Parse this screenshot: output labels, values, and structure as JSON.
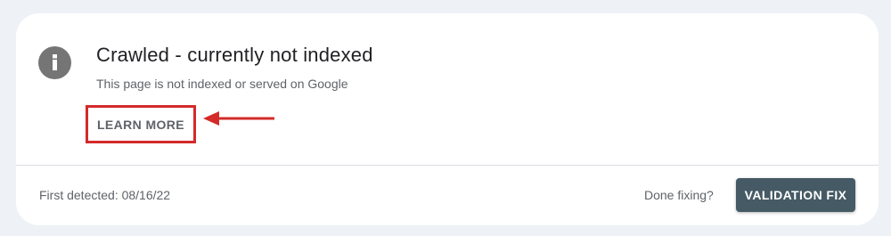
{
  "issue": {
    "icon": "info-icon",
    "title": "Crawled - currently not indexed",
    "description": "This page is not indexed or served on Google",
    "learn_more_label": "LEARN MORE"
  },
  "annotation": {
    "highlight_color": "#d42a2a",
    "arrow_icon": "arrow-left-icon"
  },
  "footer": {
    "first_detected": "First detected: 08/16/22",
    "done_fixing": "Done fixing?",
    "validation_button_label": "VALIDATION FIX"
  },
  "colors": {
    "button_bg": "#455a64",
    "icon_bg": "#757575"
  }
}
